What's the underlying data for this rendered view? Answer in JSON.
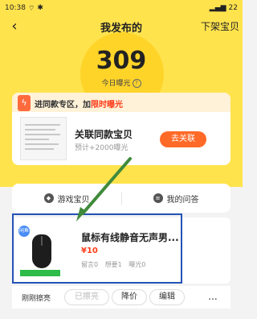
{
  "status": {
    "time": "10:38",
    "network": "4G",
    "battery": "22"
  },
  "nav": {
    "title": "我发布的",
    "right_label": "下架宝贝"
  },
  "summary": {
    "count": "309",
    "label": "今日曝光"
  },
  "promo": {
    "title_prefix": "进同款专区，加",
    "title_highlight": "限时曝光",
    "main": "关联同款宝贝",
    "sub": "预计+2000曝光",
    "button": "去关联"
  },
  "tabs": [
    {
      "label": "游戏宝贝",
      "icon": "gamepad-icon"
    },
    {
      "label": "我的问答",
      "icon": "chat-icon"
    }
  ],
  "item": {
    "title": "鼠标有线静音无声男...",
    "price": "¥10",
    "stats": [
      "留言0",
      "想要1",
      "曝光0"
    ],
    "badge": "闲鱼"
  },
  "actions": {
    "note": "刚刚擦亮",
    "buttons": [
      "已擦亮",
      "降价",
      "编辑"
    ],
    "more": "..."
  },
  "annotation": {
    "arrow_color": "#3f8a3b",
    "highlight_color": "#2453b5"
  }
}
